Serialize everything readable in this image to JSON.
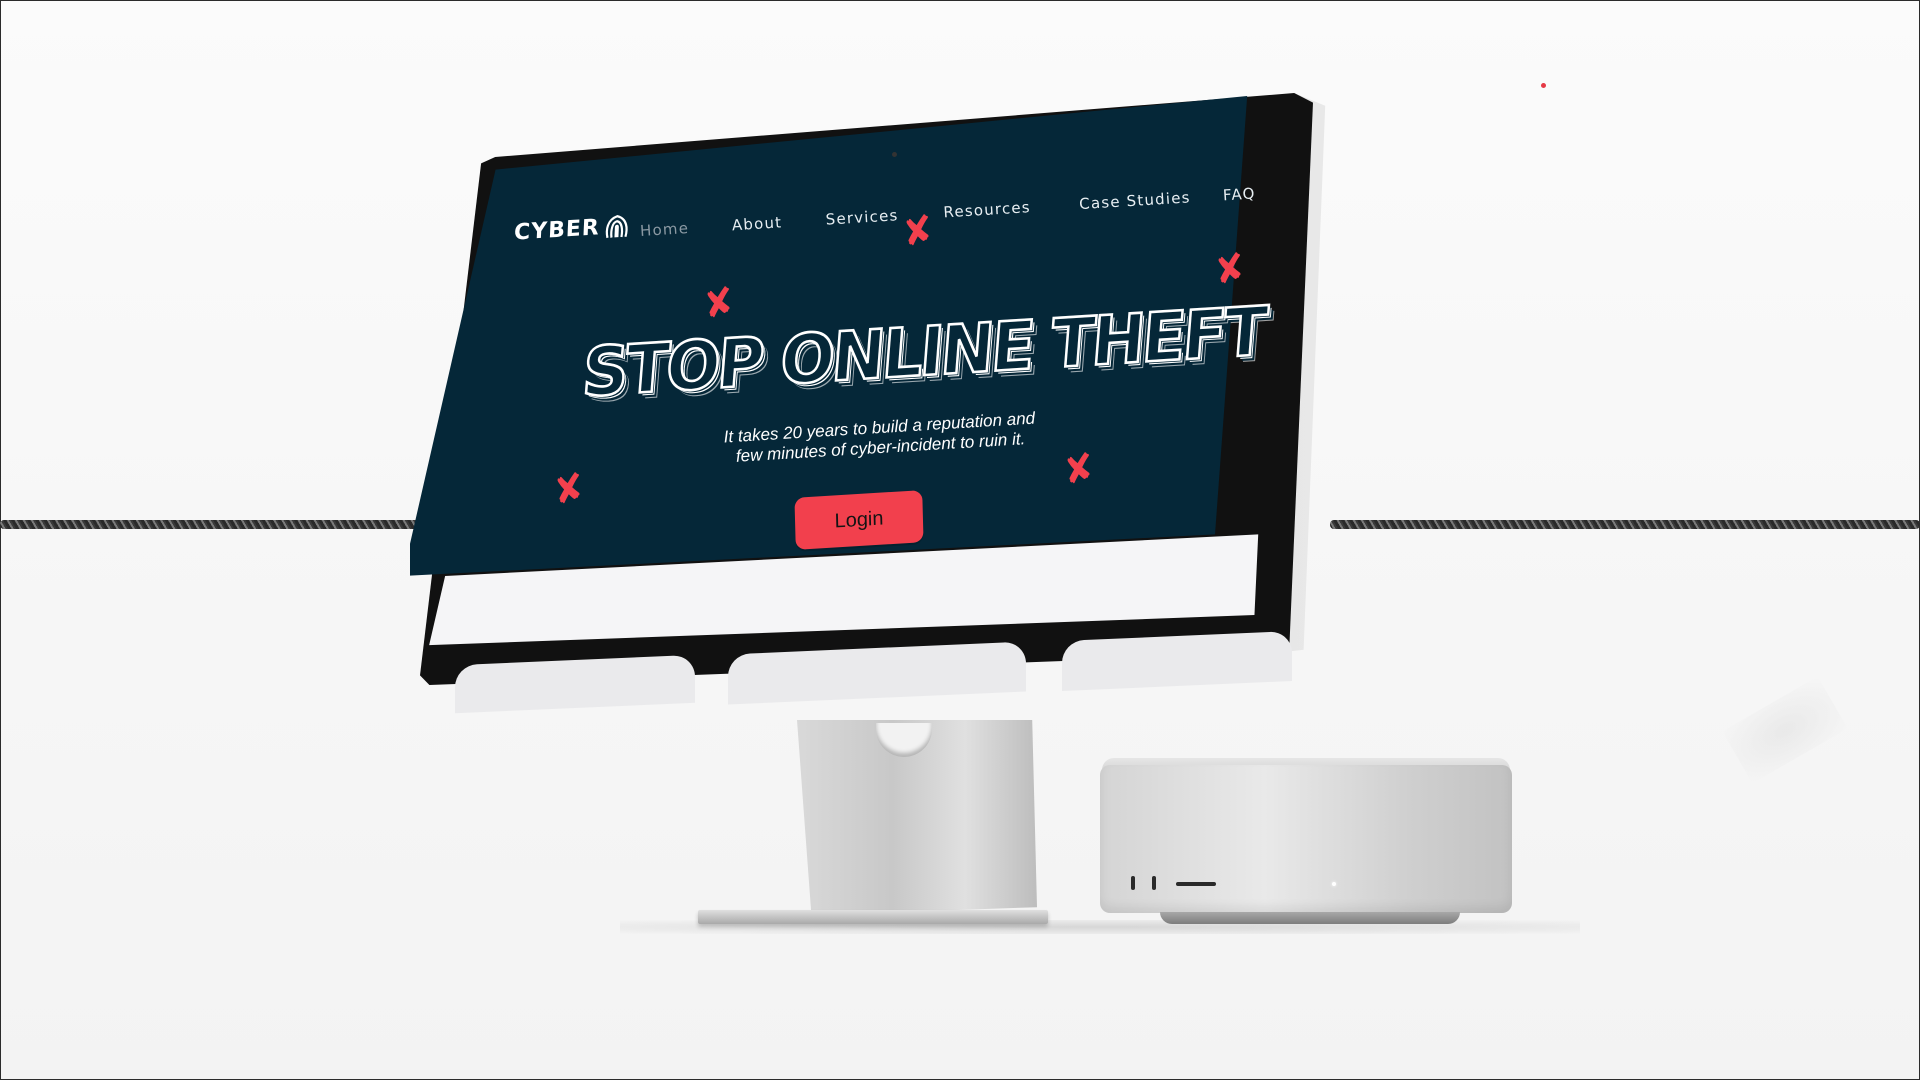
{
  "site": {
    "logo_text": "CYBER",
    "nav": {
      "home": "Home",
      "about": "About",
      "services": "Services",
      "resources": "Resources",
      "case_studies": "Case Studies",
      "faq": "FAQ"
    },
    "hero": {
      "headline": "STOP ONLINE THEFT",
      "subtext_line1": "It takes 20 years to build a reputation and",
      "subtext_line2": "few minutes of cyber-incident to ruin it.",
      "login_label": "Login"
    },
    "decoration_glyph": "✘"
  },
  "colors": {
    "hero_background": "#052738",
    "accent_red": "#f2404d",
    "nav_active": "#8a98a2",
    "nav_text": "#e7eef2",
    "page_background": "#f9f9f9"
  },
  "icons": {
    "logo_mark": "fingerprint-icon",
    "decorations": "cross-mark-icon"
  }
}
